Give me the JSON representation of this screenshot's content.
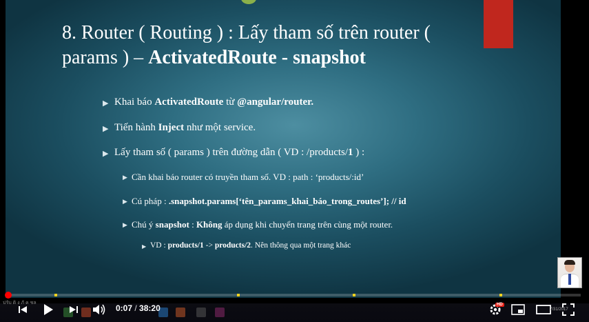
{
  "slide": {
    "title_line1": "8. Router ( Routing ) : Lấy tham số trên router (",
    "title_line2_plain": "params ) – ",
    "title_line2_bold": "ActivatedRoute - snapshot",
    "bullets": {
      "b1": {
        "t1": "Khai báo ",
        "b": "ActivatedRoute",
        "t2": " từ ",
        "b2": "@angular/router."
      },
      "b2": {
        "t1": "Tiến hành ",
        "b": "Inject",
        "t2": " như một service."
      },
      "b3": {
        "t1": "Lấy tham số ( params ) trên đường dẫn ( VD : /products/",
        "b": "1",
        "t2": " ) :"
      },
      "s1": {
        "t1": "Cần khai báo router có truyền tham số. VD : path : ‘products/:id’"
      },
      "s2": {
        "t1": "Cú pháp : ",
        "b": ".snapshot.params[‘tên_params_khai_báo_trong_routes’]; // id"
      },
      "s3": {
        "t1": "Chú ý ",
        "b": "snapshot",
        "t2": " : ",
        "b2": "Không",
        "t3": " áp dụng khi chuyển trang trên cùng một router."
      },
      "ss1": {
        "t1": "VD : ",
        "b": "products/1",
        "t2": " -> ",
        "b2": "products/2",
        "t3": ". Nên thông qua một trang khác"
      }
    }
  },
  "player": {
    "current_time": "0:07",
    "separator": " / ",
    "duration": "38:20",
    "progress_fraction": 0.005,
    "hd_label": "HD",
    "icons": [
      "previous-icon",
      "play-icon",
      "next-icon",
      "volume-icon",
      "settings-icon",
      "miniplayer-icon",
      "theater-icon",
      "fullscreen-icon"
    ]
  },
  "overlay": {
    "corner_text": "ปรับ ติ ง ภั ค ชล",
    "clock_date": "7/31/2017"
  },
  "colors": {
    "progress": "#ff0000",
    "marker": "#f4d21f",
    "hd": "#e62117",
    "red_block": "#c0271e"
  }
}
